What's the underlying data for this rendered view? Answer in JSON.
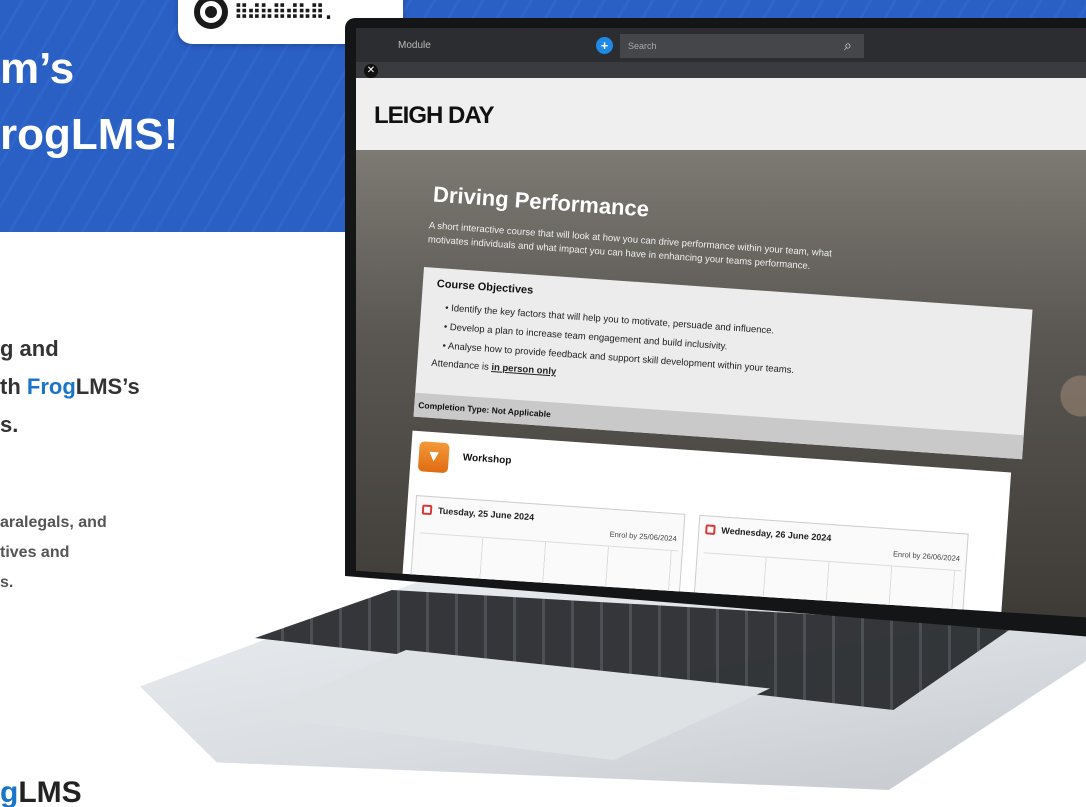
{
  "headline": {
    "line1": "m’s",
    "line2": "rogLMS!"
  },
  "body": {
    "lead_line1": "g and",
    "lead_line2_prefix": "th ",
    "lead_line2_frog": "Frog",
    "lead_line2_suffix": "LMS’s",
    "lead_line3": "s.",
    "small_line1": "aralegals, and",
    "small_line2": "tives and",
    "small_line3": "s."
  },
  "footer": {
    "brand_frog": "g",
    "brand_lms": "LMS"
  },
  "qr": {
    "pattern": "⠿⠾⠷⠿⠾⠷⠿."
  },
  "app": {
    "module_label": "Module",
    "search_placeholder": "Search",
    "logo": "LEIGH DAY",
    "course": {
      "title": "Driving Performance",
      "description": "A short interactive course that will look at how you can drive performance within your team, what motivates individuals and what impact you can have in enhancing your teams performance.",
      "objectives_title": "Course Objectives",
      "objectives": [
        "Identify the key factors that will help you to motivate, persuade and influence.",
        "Develop a plan to increase team engagement and build inclusivity.",
        "Analyse how to provide feedback and support skill development within your teams."
      ],
      "attendance_prefix": "Attendance is ",
      "attendance_value": "in person only",
      "completion_type": "Completion Type: Not Applicable"
    },
    "workshop": {
      "label": "Workshop",
      "sessions": [
        {
          "date": "Tuesday, 25 June 2024",
          "enrol_by": "Enrol by 25/06/2024"
        },
        {
          "date": "Wednesday, 26 June 2024",
          "enrol_by": "Enrol by 26/06/2024"
        }
      ]
    }
  },
  "colors": {
    "banner_blue": "#2a5fc4",
    "frog_blue": "#1a74c8",
    "workshop_orange": "#e06b12"
  }
}
